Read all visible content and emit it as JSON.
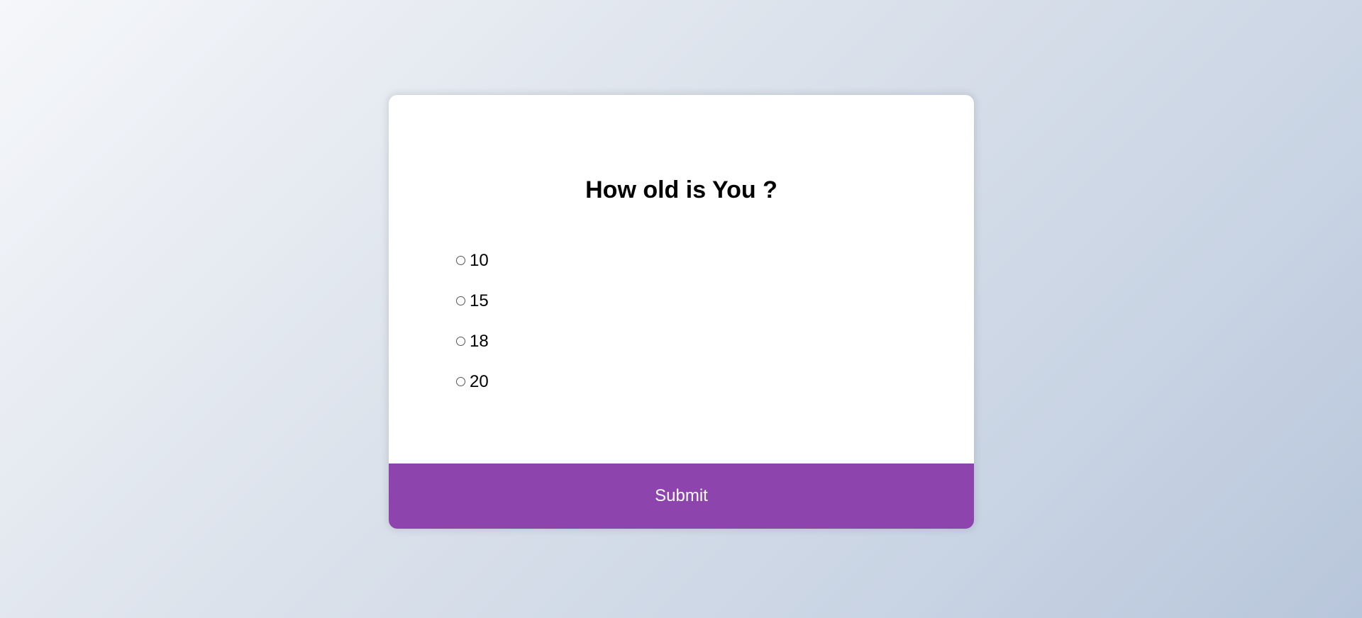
{
  "quiz": {
    "question": "How old is You ?",
    "answers": [
      {
        "label": "10",
        "selected": false
      },
      {
        "label": "15",
        "selected": false
      },
      {
        "label": "18",
        "selected": false
      },
      {
        "label": "20",
        "selected": false
      }
    ],
    "submit_label": "Submit",
    "accent_color": "#8e44ad"
  }
}
